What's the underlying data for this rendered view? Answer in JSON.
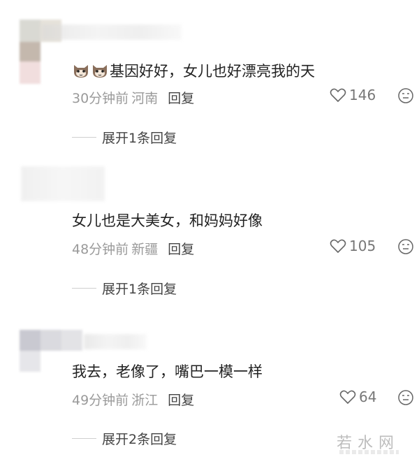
{
  "comments": [
    {
      "text": "基因好好，女儿也好漂亮我的天",
      "time": "30分钟前",
      "location": "河南",
      "reply_label": "回复",
      "likes": "146",
      "expand_label": "展开1条回复",
      "emoji_prefix": 2
    },
    {
      "text": "女儿也是大美女，和妈妈好像",
      "time": "48分钟前",
      "location": "新疆",
      "reply_label": "回复",
      "likes": "105",
      "expand_label": "展开1条回复"
    },
    {
      "text": "我去，老像了，嘴巴一模一样",
      "time": "49分钟前",
      "location": "浙江",
      "reply_label": "回复",
      "likes": "64",
      "expand_label": "展开2条回复"
    }
  ],
  "watermark": "若水网",
  "colors": {
    "meta": "#9a9a9a",
    "text": "#222222",
    "reply": "#444444"
  }
}
